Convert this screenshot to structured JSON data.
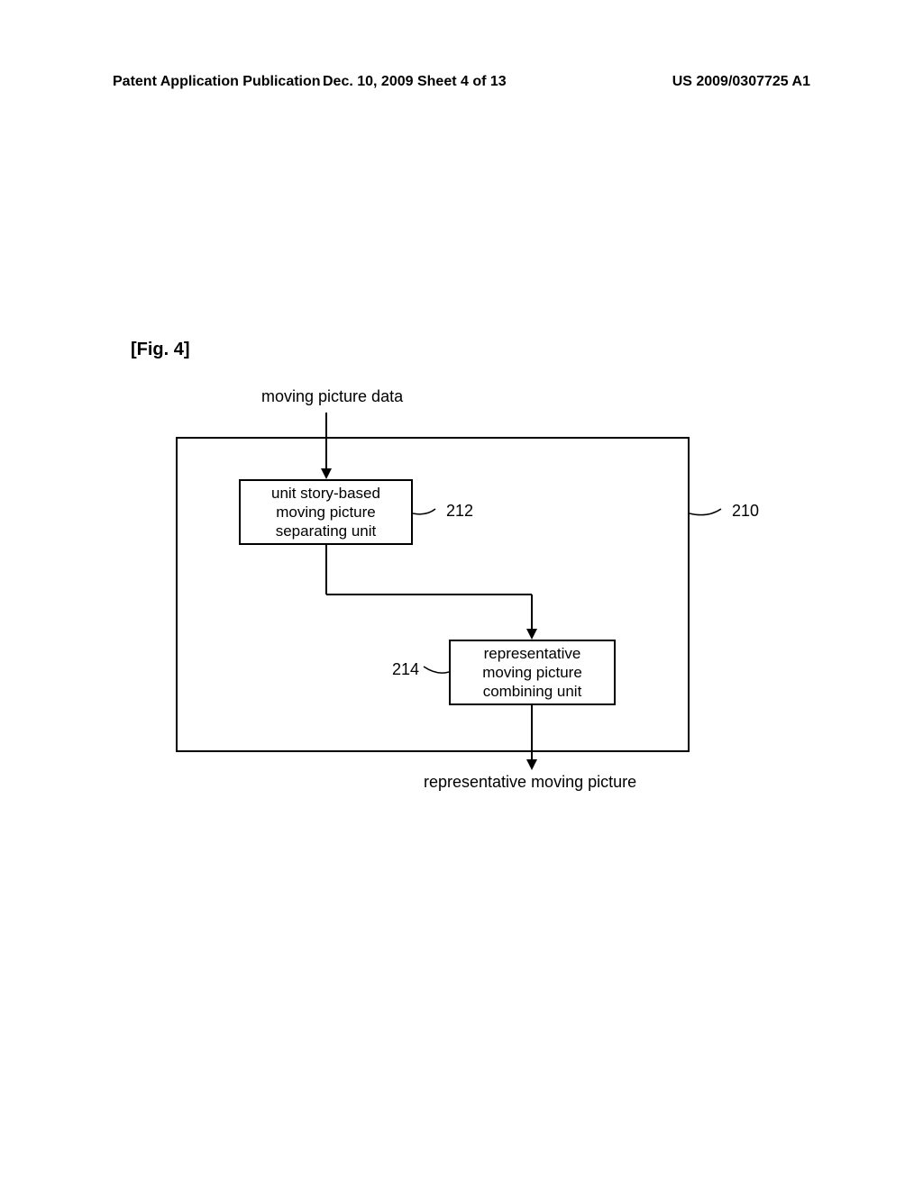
{
  "header": {
    "left": "Patent Application Publication",
    "center": "Dec. 10, 2009  Sheet 4 of 13",
    "right": "US 2009/0307725 A1"
  },
  "figure_label": "[Fig. 4]",
  "diagram": {
    "input_label": "moving picture data",
    "box_212_text": "unit story-based\nmoving picture\nseparating unit",
    "box_214_text": "representative\nmoving picture\ncombining unit",
    "label_212": "212",
    "label_214": "214",
    "label_210": "210",
    "output_label": "representative moving picture"
  }
}
